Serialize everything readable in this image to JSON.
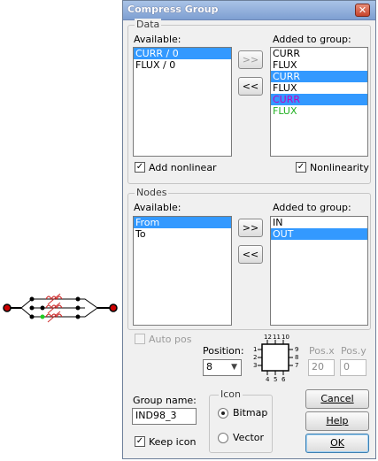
{
  "window": {
    "title": "Compress Group",
    "close_symbol": "✕"
  },
  "data_group": {
    "legend": "Data",
    "available_label": "Available:",
    "added_label": "Added to group:",
    "available_items": [
      {
        "label": "CURR / 0",
        "selected": true
      },
      {
        "label": "FLUX / 0",
        "selected": false
      }
    ],
    "added_items": [
      {
        "label": "CURR",
        "selected": false,
        "color": "#000000"
      },
      {
        "label": "FLUX",
        "selected": false,
        "color": "#000000"
      },
      {
        "label": "CURR",
        "selected": true,
        "color": "#000000"
      },
      {
        "label": "FLUX",
        "selected": false,
        "color": "#000000"
      },
      {
        "label": "CURR",
        "selected": true,
        "color": "#c000c0"
      },
      {
        "label": "FLUX",
        "selected": false,
        "color": "#22b022"
      }
    ],
    "add_button": ">>",
    "remove_button": "<<",
    "add_nonlinear_label": "Add nonlinear",
    "add_nonlinear_checked": true,
    "nonlinearity_label": "Nonlinearity",
    "nonlinearity_checked": true
  },
  "nodes_group": {
    "legend": "Nodes",
    "available_label": "Available:",
    "added_label": "Added to group:",
    "available_items": [
      {
        "label": "From",
        "selected": true
      },
      {
        "label": "To",
        "selected": false
      }
    ],
    "added_items": [
      {
        "label": "IN",
        "selected": false
      },
      {
        "label": "OUT",
        "selected": true
      }
    ],
    "add_button": ">>",
    "remove_button": "<<"
  },
  "position": {
    "auto_pos_label": "Auto pos",
    "position_label": "Position:",
    "position_value": "8",
    "pin_numbers_top": [
      "12",
      "11",
      "10"
    ],
    "pin_numbers_left": [
      "1",
      "2",
      "3"
    ],
    "pin_numbers_right": [
      "9",
      "8",
      "7"
    ],
    "pin_numbers_bottom": [
      "4",
      "5",
      "6"
    ],
    "pos_x_label": "Pos.x",
    "pos_x_value": "20",
    "pos_y_label": "Pos.y",
    "pos_y_value": "0"
  },
  "group_name": {
    "label": "Group name:",
    "value": "IND98_3",
    "keep_icon_label": "Keep icon",
    "keep_icon_checked": true
  },
  "icon_group": {
    "legend": "Icon",
    "bitmap_label": "Bitmap",
    "vector_label": "Vector",
    "selected": "Bitmap"
  },
  "buttons": {
    "cancel": "Cancel",
    "help": "Help",
    "ok": "OK"
  },
  "colors": {
    "selection": "#3399ff",
    "node_red": "#cc0000",
    "node_green": "#22cc22",
    "coil_red": "#d03030"
  }
}
